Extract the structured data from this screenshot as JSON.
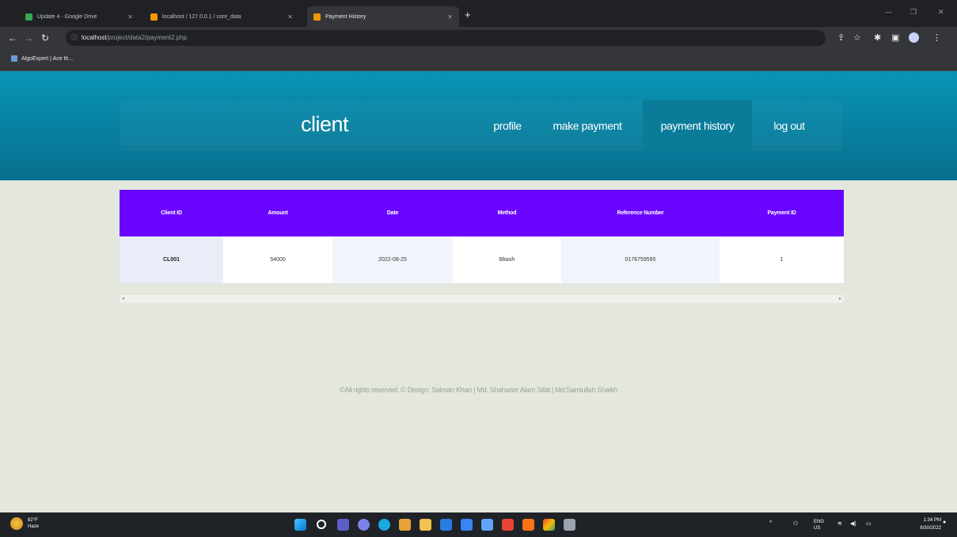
{
  "browser": {
    "tabs": [
      {
        "label": "Update 4 - Google Drive",
        "active": false,
        "favicon_color": "#34a853"
      },
      {
        "label": "localhost / 127.0.0.1 / core_data",
        "active": false,
        "favicon_color": "#f29900"
      },
      {
        "label": "Payment History",
        "active": true,
        "favicon_color": "#f29900"
      }
    ],
    "new_tab": "+",
    "url_host": "localhost",
    "url_path": "/project/data2/payment2.php",
    "bookmark": "AlgoExpert | Ace th..."
  },
  "site": {
    "brand": "client",
    "nav": [
      {
        "label": "profile",
        "active": false
      },
      {
        "label": "make payment",
        "active": false
      },
      {
        "label": "payment history",
        "active": true
      },
      {
        "label": "log out",
        "active": false
      }
    ]
  },
  "table": {
    "headers": [
      "Client ID",
      "Amount",
      "Date",
      "Method",
      "Reference Number",
      "Payment ID"
    ],
    "rows": [
      [
        "CL001",
        "54000",
        "2022-08-25",
        "Bkash",
        "0176759595",
        "1"
      ]
    ]
  },
  "footer": {
    "text": "©All rights reserved. © Design: Salman Khan | Md. Shaharier Alam Sifat | Md.Samiullah Shaikh"
  },
  "taskbar": {
    "weather_temp": "82°F",
    "weather_desc": "Haze",
    "lang": "ENG",
    "region": "US",
    "time": "1:34 PM",
    "date": "8/30/2022"
  },
  "colors": {
    "header_teal": "#0894b5",
    "table_header_purple": "#6a05ff",
    "page_background": "#e3e7dd"
  }
}
